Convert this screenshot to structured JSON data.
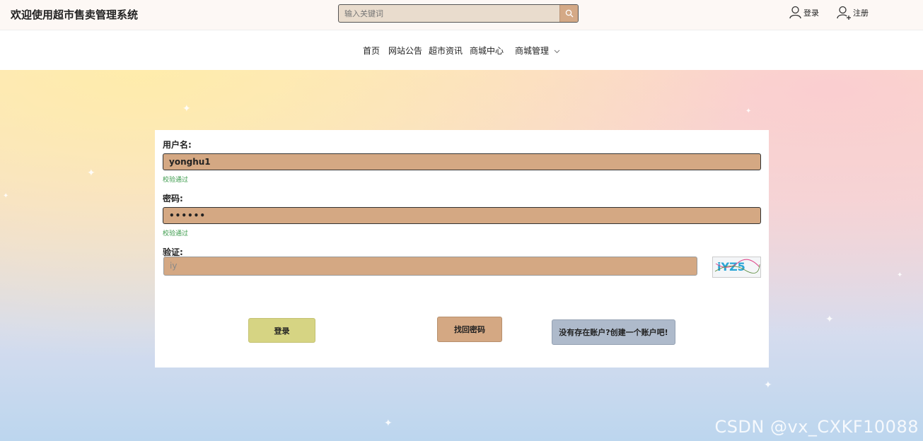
{
  "header": {
    "title": "欢迎使用超市售卖管理系统",
    "search_placeholder": "输入关键词",
    "search_value": "输入关键词",
    "login_label": "登录",
    "register_label": "注册"
  },
  "nav": {
    "items": [
      "首页",
      "网站公告",
      "超市资讯",
      "商城中心",
      "商城管理"
    ]
  },
  "form": {
    "username_label": "用户名:",
    "username_value": "yonghu1",
    "username_status": "校验通过",
    "password_label": "密码:",
    "password_value": "••••••",
    "password_status": "校验通过",
    "captcha_label": "验证:",
    "captcha_value": "iy",
    "captcha_image_text": "iYZ5",
    "login_button": "登录",
    "forgot_button": "找回密码",
    "register_button": "没有存在账户?创建一个账户吧!"
  },
  "watermark": "CSDN @vx_CXKF10088",
  "colors": {
    "input_bg": "#d4a883",
    "login_btn": "#d6d483",
    "forgot_btn": "#d4a883",
    "register_btn": "#aebacb",
    "valid_green": "#3a9a4a"
  }
}
